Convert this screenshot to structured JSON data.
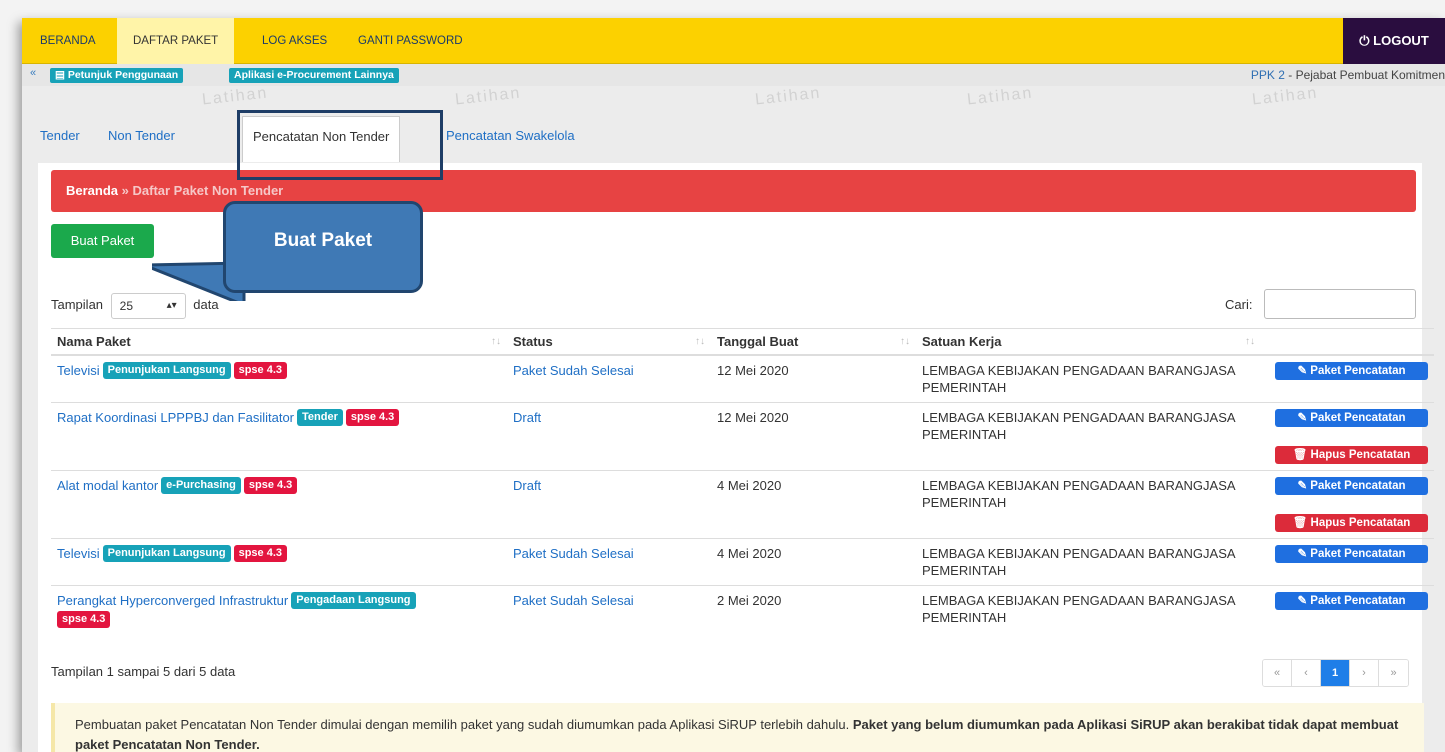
{
  "topnav": {
    "items": [
      "BERANDA",
      "DAFTAR PAKET",
      "LOG AKSES",
      "GANTI PASSWORD"
    ],
    "logout": "LOGOUT"
  },
  "subbar": {
    "petunjuk": "Petunjuk Penggunaan",
    "aplikasi": "Aplikasi e-Procurement Lainnya",
    "ppk_code": "PPK 2",
    "ppk_role": " - Pejabat Pembuat Komitmen"
  },
  "watermark": "Latihan",
  "tabs": [
    "Tender",
    "Non Tender",
    "Pencatatan Non Tender",
    "Pencatatan Swakelola"
  ],
  "breadcrumb": {
    "home": "Beranda",
    "sep": " » ",
    "current": "Daftar Paket Non Tender"
  },
  "buat_paket_button": "Buat Paket",
  "callout": "Buat Paket",
  "length": {
    "prefix": "Tampilan",
    "value": "25",
    "suffix": "data"
  },
  "search_label": "Cari:",
  "table": {
    "headers": [
      "Nama Paket",
      "Status",
      "Tanggal Buat",
      "Satuan Kerja",
      ""
    ],
    "rows": [
      {
        "name": "Televisi",
        "method": "Penunjukan Langsung",
        "version": "spse 4.3",
        "status": "Paket Sudah Selesai",
        "date": "12 Mei 2020",
        "unit": "LEMBAGA KEBIJAKAN PENGADAAN BARANGJASA PEMERINTAH",
        "btn": "Paket Pencatatan"
      },
      {
        "name": "Rapat Koordinasi LPPPBJ dan Fasilitator",
        "method": "Tender",
        "version": "spse 4.3",
        "status": "Draft",
        "date": "12 Mei 2020",
        "unit": "LEMBAGA KEBIJAKAN PENGADAAN BARANGJASA PEMERINTAH",
        "btn": "Paket Pencatatan",
        "delete": "Hapus Pencatatan"
      },
      {
        "name": "Alat modal kantor",
        "method": "e-Purchasing",
        "version": "spse 4.3",
        "status": "Draft",
        "date": "4 Mei 2020",
        "unit": "LEMBAGA KEBIJAKAN PENGADAAN BARANGJASA PEMERINTAH",
        "btn": "Paket Pencatatan",
        "delete": "Hapus Pencatatan"
      },
      {
        "name": "Televisi",
        "method": "Penunjukan Langsung",
        "version": "spse 4.3",
        "status": "Paket Sudah Selesai",
        "date": "4 Mei 2020",
        "unit": "LEMBAGA KEBIJAKAN PENGADAAN BARANGJASA PEMERINTAH",
        "btn": "Paket Pencatatan"
      },
      {
        "name": "Perangkat Hyperconverged Infrastruktur",
        "method": "Pengadaan Langsung",
        "version": "spse 4.3",
        "status": "Paket Sudah Selesai",
        "date": "2 Mei 2020",
        "unit": "LEMBAGA KEBIJAKAN PENGADAAN BARANGJASA PEMERINTAH",
        "btn": "Paket Pencatatan"
      }
    ]
  },
  "info": "Tampilan 1 sampai 5 dari 5 data",
  "pagination": {
    "first": "«",
    "prev": "‹",
    "current": "1",
    "next": "›",
    "last": "»"
  },
  "alert": {
    "text": "Pembuatan paket Pencatatan Non Tender dimulai dengan memilih paket yang sudah diumumkan pada Aplikasi SiRUP terlebih dahulu. ",
    "bold": "Paket yang belum diumumkan pada Aplikasi SiRUP akan berakibat tidak dapat membuat paket Pencatatan Non Tender."
  },
  "colors": {
    "nav": "#fcd100",
    "logout": "#2a0d3f",
    "breadcrumb": "#e74343",
    "success": "#1ba94c",
    "primary": "#1f6fe0",
    "teal": "#17a2b8",
    "danger": "#e3153f"
  }
}
